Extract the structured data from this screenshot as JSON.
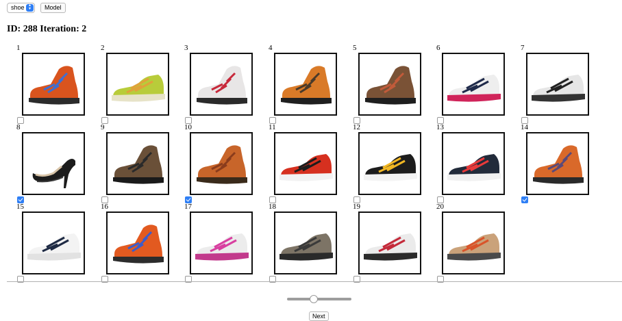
{
  "controls": {
    "category_value": "shoe",
    "model_label": "Model"
  },
  "heading": "ID: 288 Iteration: 2",
  "items": [
    {
      "number": "1",
      "checked": false,
      "shoe": "boot",
      "upper": "#d9541e",
      "accent": "#3f6fd0",
      "sole": "#2b2b2b"
    },
    {
      "number": "2",
      "checked": false,
      "shoe": "sneaker",
      "upper": "#b8cc3a",
      "accent": "#e0a23a",
      "sole": "#e7e3c8"
    },
    {
      "number": "3",
      "checked": false,
      "shoe": "boot",
      "upper": "#e8e6e6",
      "accent": "#c7283a",
      "sole": "#2a2a2a"
    },
    {
      "number": "4",
      "checked": false,
      "shoe": "boot",
      "upper": "#d97a28",
      "accent": "#4a3a2a",
      "sole": "#1f1f1f"
    },
    {
      "number": "5",
      "checked": false,
      "shoe": "boot",
      "upper": "#7a5236",
      "accent": "#c25b3a",
      "sole": "#1e1e1e"
    },
    {
      "number": "6",
      "checked": false,
      "shoe": "sneaker",
      "upper": "#eeeeee",
      "accent": "#1f2a4a",
      "sole": "#d0245a"
    },
    {
      "number": "7",
      "checked": false,
      "shoe": "sneaker",
      "upper": "#e6e6e6",
      "accent": "#222222",
      "sole": "#333333"
    },
    {
      "number": "8",
      "checked": true,
      "shoe": "heel",
      "upper": "#1c1c1c",
      "accent": "#d8c4a8",
      "sole": "#3a3a3a"
    },
    {
      "number": "9",
      "checked": false,
      "shoe": "boot",
      "upper": "#6a5038",
      "accent": "#2a2a2a",
      "sole": "#1a1a1a"
    },
    {
      "number": "10",
      "checked": true,
      "shoe": "boot",
      "upper": "#c8652a",
      "accent": "#8a3c1c",
      "sole": "#3a2a1a"
    },
    {
      "number": "11",
      "checked": false,
      "shoe": "sneaker",
      "upper": "#d6301f",
      "accent": "#1c1c1c",
      "sole": "#f2f2f2"
    },
    {
      "number": "12",
      "checked": false,
      "shoe": "sneaker",
      "upper": "#1d1d1d",
      "accent": "#f2b824",
      "sole": "#f4f4f4"
    },
    {
      "number": "13",
      "checked": false,
      "shoe": "sneaker",
      "upper": "#222b3a",
      "accent": "#e93a3a",
      "sole": "#f1f1f1"
    },
    {
      "number": "14",
      "checked": true,
      "shoe": "boot",
      "upper": "#d9692a",
      "accent": "#5a4a7a",
      "sole": "#2a2a2a"
    },
    {
      "number": "15",
      "checked": false,
      "shoe": "sneaker",
      "upper": "#f3f3f3",
      "accent": "#1e2a44",
      "sole": "#e2e2e2"
    },
    {
      "number": "16",
      "checked": false,
      "shoe": "boot",
      "upper": "#e25a20",
      "accent": "#3b5ccc",
      "sole": "#2c2c2c"
    },
    {
      "number": "17",
      "checked": false,
      "shoe": "sneaker",
      "upper": "#ececec",
      "accent": "#d83fa0",
      "sole": "#c23a8c"
    },
    {
      "number": "18",
      "checked": false,
      "shoe": "sneaker",
      "upper": "#7d7466",
      "accent": "#3a3a3a",
      "sole": "#2a2a2a"
    },
    {
      "number": "19",
      "checked": false,
      "shoe": "sneaker",
      "upper": "#ebebeb",
      "accent": "#c42a3a",
      "sole": "#2b2b2b"
    },
    {
      "number": "20",
      "checked": false,
      "shoe": "sneaker",
      "upper": "#caa27a",
      "accent": "#d9542a",
      "sole": "#4a4a4a"
    }
  ],
  "slider": {
    "value_fraction": 0.4
  },
  "next_label": "Next"
}
